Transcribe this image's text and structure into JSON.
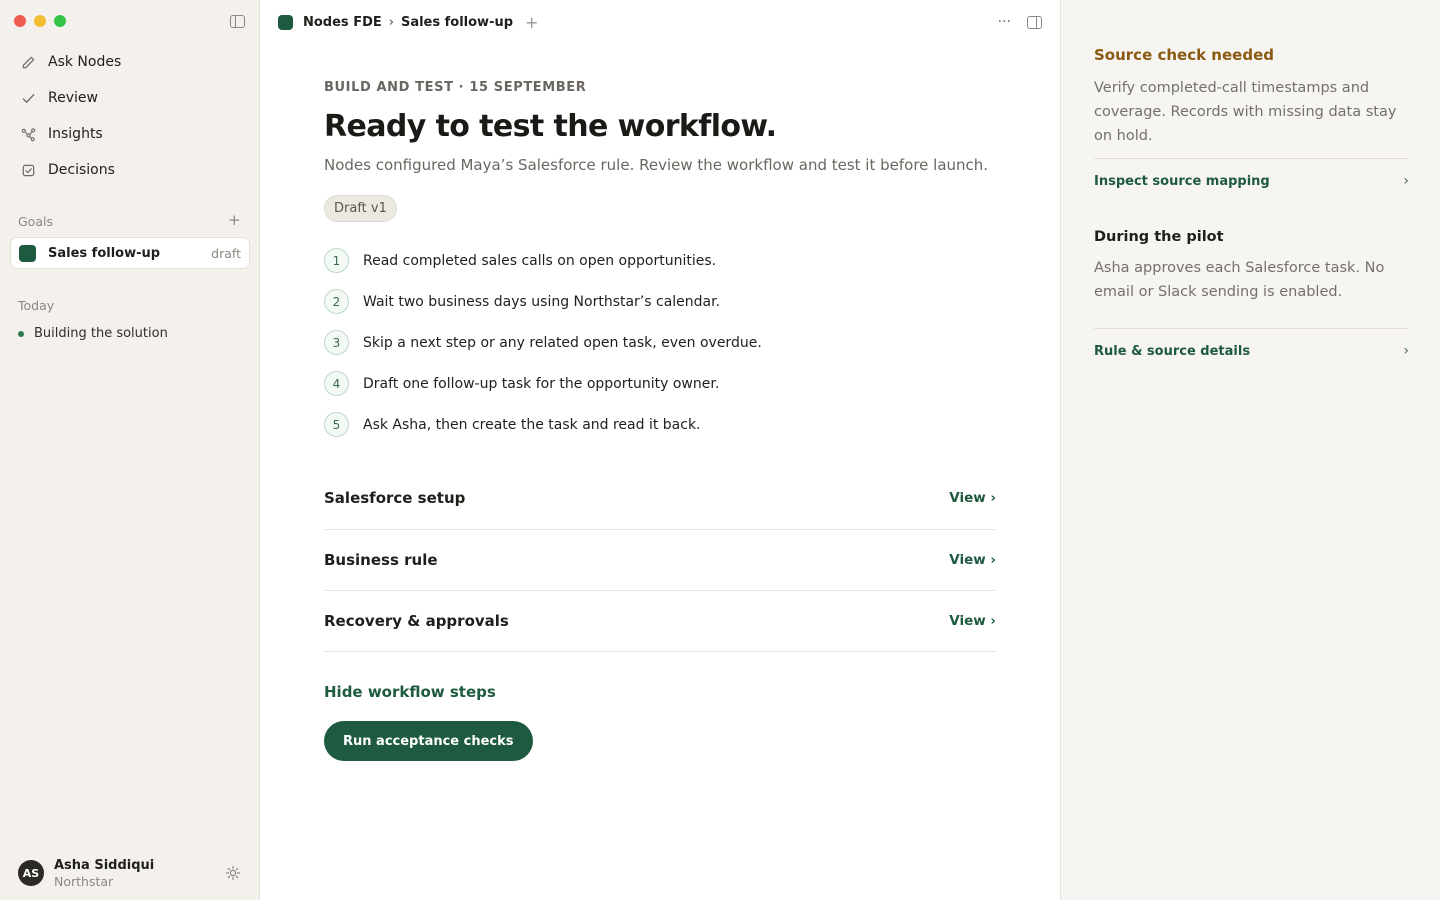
{
  "sidebar": {
    "nav": [
      {
        "label": "Ask Nodes",
        "icon": "pencil-icon"
      },
      {
        "label": "Review",
        "icon": "check-icon"
      },
      {
        "label": "Insights",
        "icon": "graph-nodes-icon"
      },
      {
        "label": "Decisions",
        "icon": "checkbox-icon"
      }
    ],
    "goals_label": "Goals",
    "goals_add": "+",
    "goal": {
      "label": "Sales follow-up",
      "badge": "draft"
    },
    "today_label": "Today",
    "today_item": "Building the solution",
    "user": {
      "initials": "AS",
      "name": "Asha Siddiqui",
      "org": "Northstar"
    }
  },
  "header": {
    "workspace": "Nodes FDE",
    "separator": "›",
    "page": "Sales follow-up",
    "add": "+",
    "more": "···"
  },
  "main": {
    "eyebrow": "BUILD AND TEST · 15 SEPTEMBER",
    "title": "Ready to test the workflow.",
    "subtitle": "Nodes configured Maya’s Salesforce rule. Review the workflow and test it before launch.",
    "chip": "Draft v1",
    "steps": [
      {
        "num": "1",
        "text": "Read completed sales calls on open opportunities."
      },
      {
        "num": "2",
        "text": "Wait two business days using Northstar’s calendar."
      },
      {
        "num": "3",
        "text": "Skip a next step or any related open task, even overdue."
      },
      {
        "num": "4",
        "text": "Draft one follow-up task for the opportunity owner."
      },
      {
        "num": "5",
        "text": "Ask Asha, then create the task and read it back."
      }
    ],
    "sections": [
      {
        "title": "Salesforce setup",
        "action": "View ›"
      },
      {
        "title": "Business rule",
        "action": "View ›"
      },
      {
        "title": "Recovery & approvals",
        "action": "View ›"
      }
    ],
    "hide_link": "Hide workflow steps",
    "run_button": "Run acceptance checks"
  },
  "right_panel": {
    "source_check": {
      "title": "Source check needed",
      "body": "Verify completed-call timestamps and coverage. Records with missing data stay on hold.",
      "link": "Inspect source mapping"
    },
    "pilot": {
      "title": "During the pilot",
      "body": "Asha approves each Salesforce task. No email or Slack sending is enabled.",
      "link": "Rule & source details"
    },
    "chevron": "›"
  },
  "colors": {
    "accent": "#1e5a3f",
    "warning": "#8a5a12",
    "sidebar_bg": "#f4f1ec",
    "panel_bg": "#f7f5f1"
  }
}
